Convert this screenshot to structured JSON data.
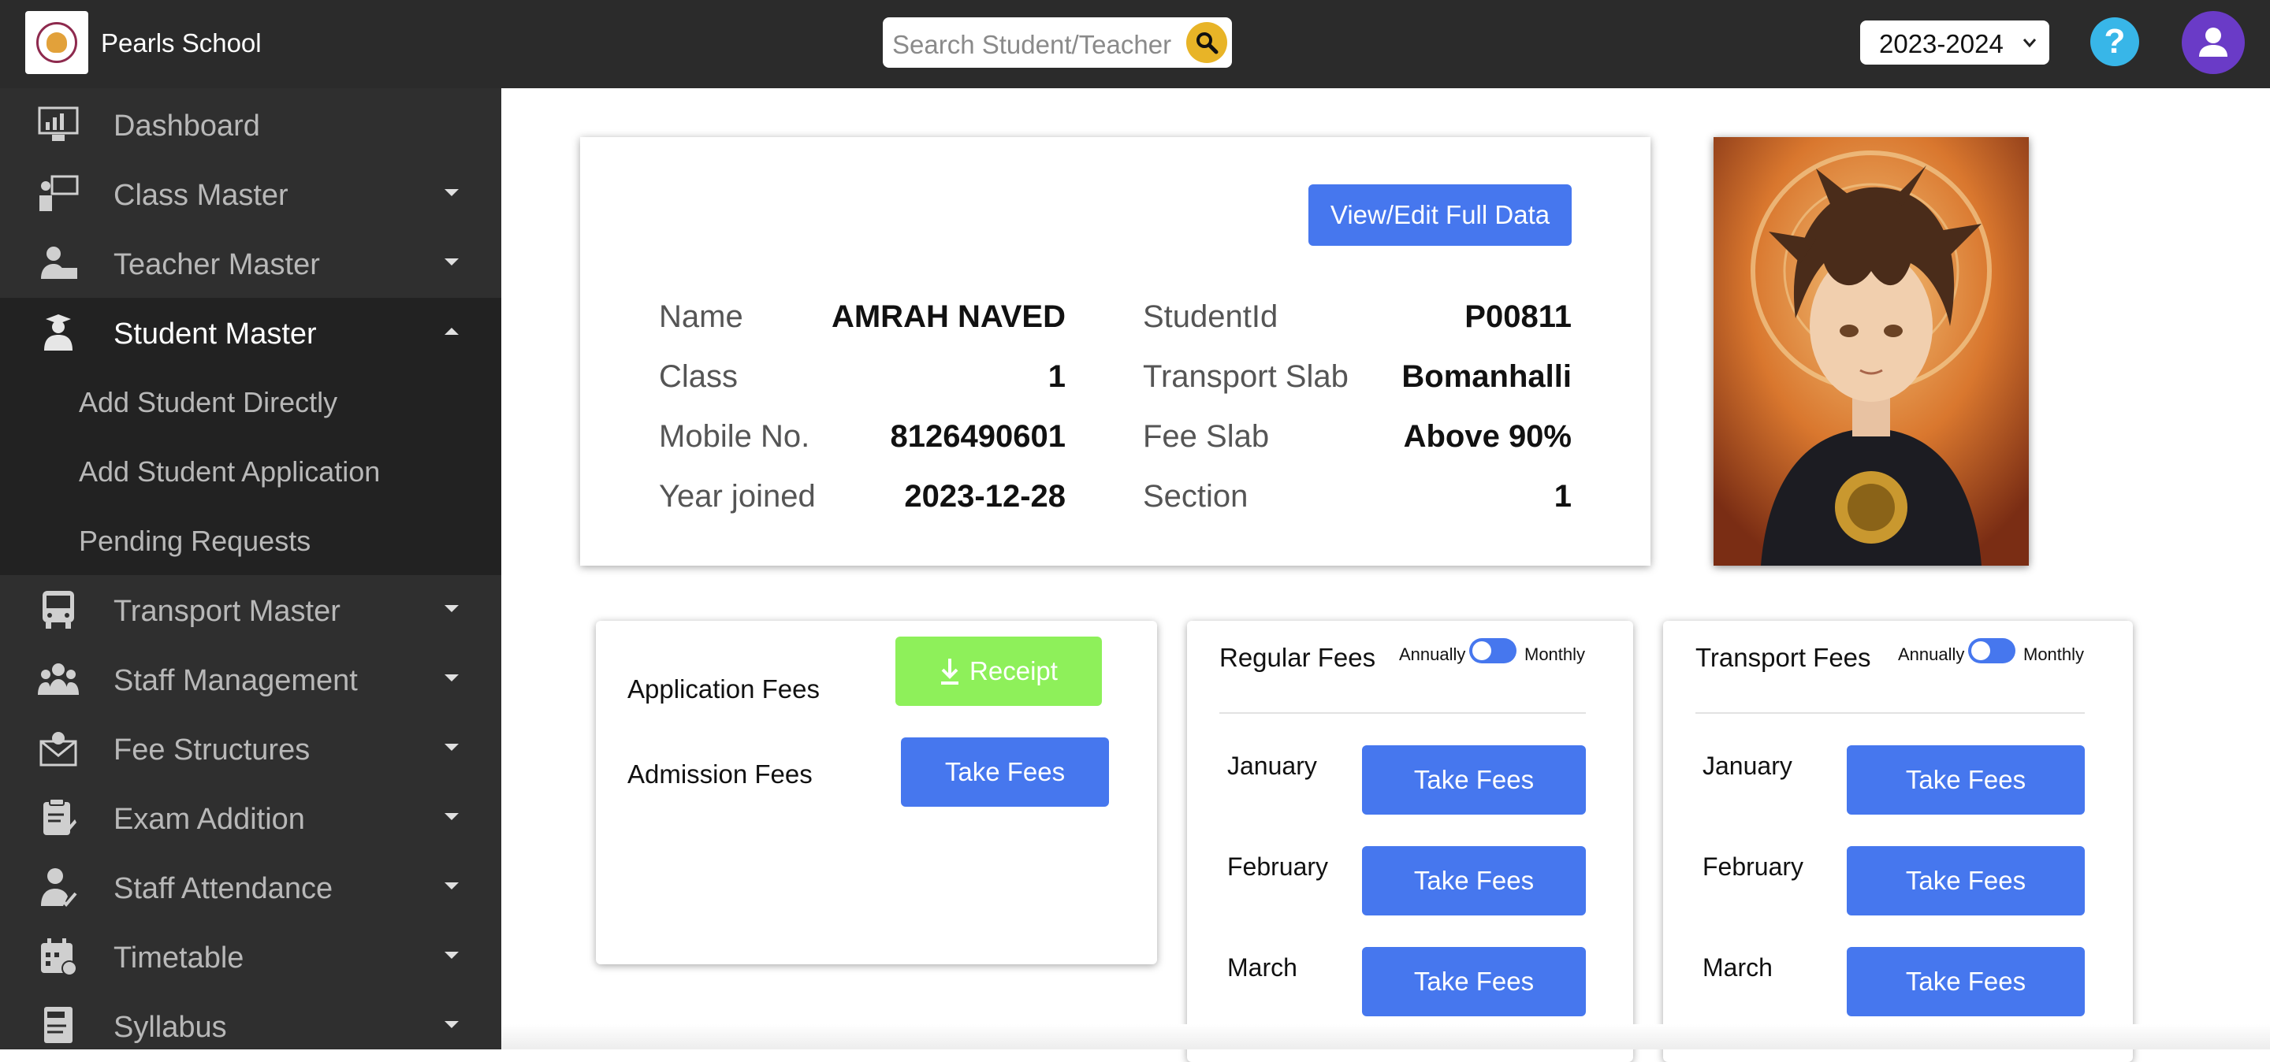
{
  "header": {
    "school_name": "Pearls School",
    "search_placeholder": "Search Student/Teacher",
    "academic_year": "2023-2024",
    "help_label": "?"
  },
  "sidebar": {
    "items": [
      {
        "label": "Dashboard",
        "icon": "dashboard-icon"
      },
      {
        "label": "Class Master",
        "icon": "class-icon"
      },
      {
        "label": "Teacher Master",
        "icon": "teacher-icon"
      },
      {
        "label": "Student Master",
        "icon": "student-icon"
      },
      {
        "label": "Transport Master",
        "icon": "bus-icon"
      },
      {
        "label": "Staff Management",
        "icon": "staff-icon"
      },
      {
        "label": "Fee Structures",
        "icon": "fee-icon"
      },
      {
        "label": "Exam Addition",
        "icon": "exam-icon"
      },
      {
        "label": "Staff Attendance",
        "icon": "attendance-icon"
      },
      {
        "label": "Timetable",
        "icon": "calendar-icon"
      },
      {
        "label": "Syllabus",
        "icon": "syllabus-icon"
      }
    ],
    "student_submenu": [
      "Add Student Directly",
      "Add Student Application",
      "Pending Requests"
    ]
  },
  "student": {
    "view_edit_label": "View/Edit Full Data",
    "fields": {
      "name_label": "Name",
      "name_value": "AMRAH NAVED",
      "class_label": "Class",
      "class_value": "1",
      "mobile_label": "Mobile No.",
      "mobile_value": "8126490601",
      "year_label": "Year joined",
      "year_value": "2023-12-28",
      "id_label": "StudentId",
      "id_value": "P00811",
      "transport_label": "Transport Slab",
      "transport_value": "Bomanhalli",
      "feeslab_label": "Fee Slab",
      "feeslab_value": "Above 90%",
      "section_label": "Section",
      "section_value": "1"
    }
  },
  "fees": {
    "application_label": "Application Fees",
    "admission_label": "Admission Fees",
    "receipt_label": "Receipt",
    "take_fees_label": "Take Fees",
    "regular": {
      "title": "Regular Fees",
      "toggle_left": "Annually",
      "toggle_right": "Monthly",
      "toggle_state": "Annually",
      "months": [
        "January",
        "February",
        "March"
      ]
    },
    "transport": {
      "title": "Transport Fees",
      "toggle_left": "Annually",
      "toggle_right": "Monthly",
      "toggle_state": "Annually",
      "months": [
        "January",
        "February",
        "March"
      ]
    }
  },
  "colors": {
    "topbar": "#2b2b2b",
    "sidebar": "#2f2f2f",
    "primary": "#4677ee",
    "receipt": "#8ef05a",
    "search_button": "#e8b427",
    "avatar": "#6a3bc7",
    "help": "#38b6e8"
  }
}
